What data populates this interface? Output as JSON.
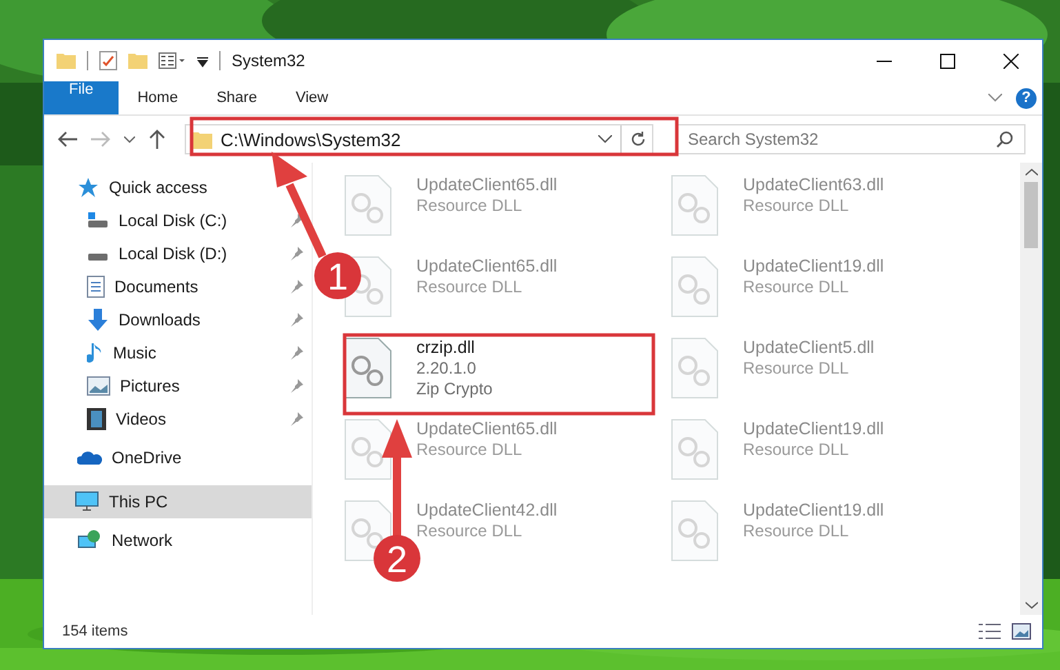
{
  "window": {
    "title": "System32"
  },
  "ribbon": {
    "tabs": [
      {
        "label": "File",
        "kind": "file",
        "selected": false
      },
      {
        "label": "Home",
        "kind": "tab",
        "selected": false
      },
      {
        "label": "Share",
        "kind": "tab",
        "selected": false
      },
      {
        "label": "View",
        "kind": "tab",
        "selected": false
      }
    ],
    "help": "?"
  },
  "address": {
    "path": "C:\\Windows\\System32"
  },
  "search": {
    "placeholder": "Search System32"
  },
  "sidebar": {
    "items": [
      {
        "label": "Quick access",
        "selected": false,
        "children": [
          {
            "label": "Local Disk (C:)",
            "selected": false
          },
          {
            "label": "Local Disk (D:)",
            "selected": false
          },
          {
            "label": "Documents",
            "selected": false
          },
          {
            "label": "Downloads",
            "selected": false
          },
          {
            "label": "Music",
            "selected": false
          },
          {
            "label": "Pictures",
            "selected": false
          },
          {
            "label": "Videos",
            "selected": false
          }
        ]
      },
      {
        "label": "OneDrive",
        "selected": false
      },
      {
        "label": "This PC",
        "selected": true
      },
      {
        "label": "Network",
        "selected": false
      }
    ]
  },
  "files": [
    {
      "name": "UpdateClient65.dll",
      "lines": [
        "Resource DLL"
      ],
      "dimmed": true
    },
    {
      "name": "UpdateClient63.dll",
      "lines": [
        "Resource DLL"
      ],
      "dimmed": true
    },
    {
      "name": "UpdateClient65.dll",
      "lines": [
        "Resource DLL"
      ],
      "dimmed": true
    },
    {
      "name": "UpdateClient19.dll",
      "lines": [
        "Resource DLL"
      ],
      "dimmed": true
    },
    {
      "name": "crzip.dll",
      "lines": [
        "2.20.1.0",
        "Zip Crypto"
      ],
      "dimmed": false
    },
    {
      "name": "UpdateClient5.dll",
      "lines": [
        "Resource DLL"
      ],
      "dimmed": true
    },
    {
      "name": "UpdateClient65.dll",
      "lines": [
        "Resource DLL"
      ],
      "dimmed": true
    },
    {
      "name": "UpdateClient19.dll",
      "lines": [
        "Resource DLL"
      ],
      "dimmed": true
    },
    {
      "name": "UpdateClient42.dll",
      "lines": [
        "Resource DLL"
      ],
      "dimmed": true
    },
    {
      "name": "UpdateClient19.dll",
      "lines": [
        "Resource DLL"
      ],
      "dimmed": true
    }
  ],
  "status_bar": {
    "count": "154 items"
  },
  "annotations": [
    {
      "label": "1"
    },
    {
      "label": "2"
    }
  ]
}
